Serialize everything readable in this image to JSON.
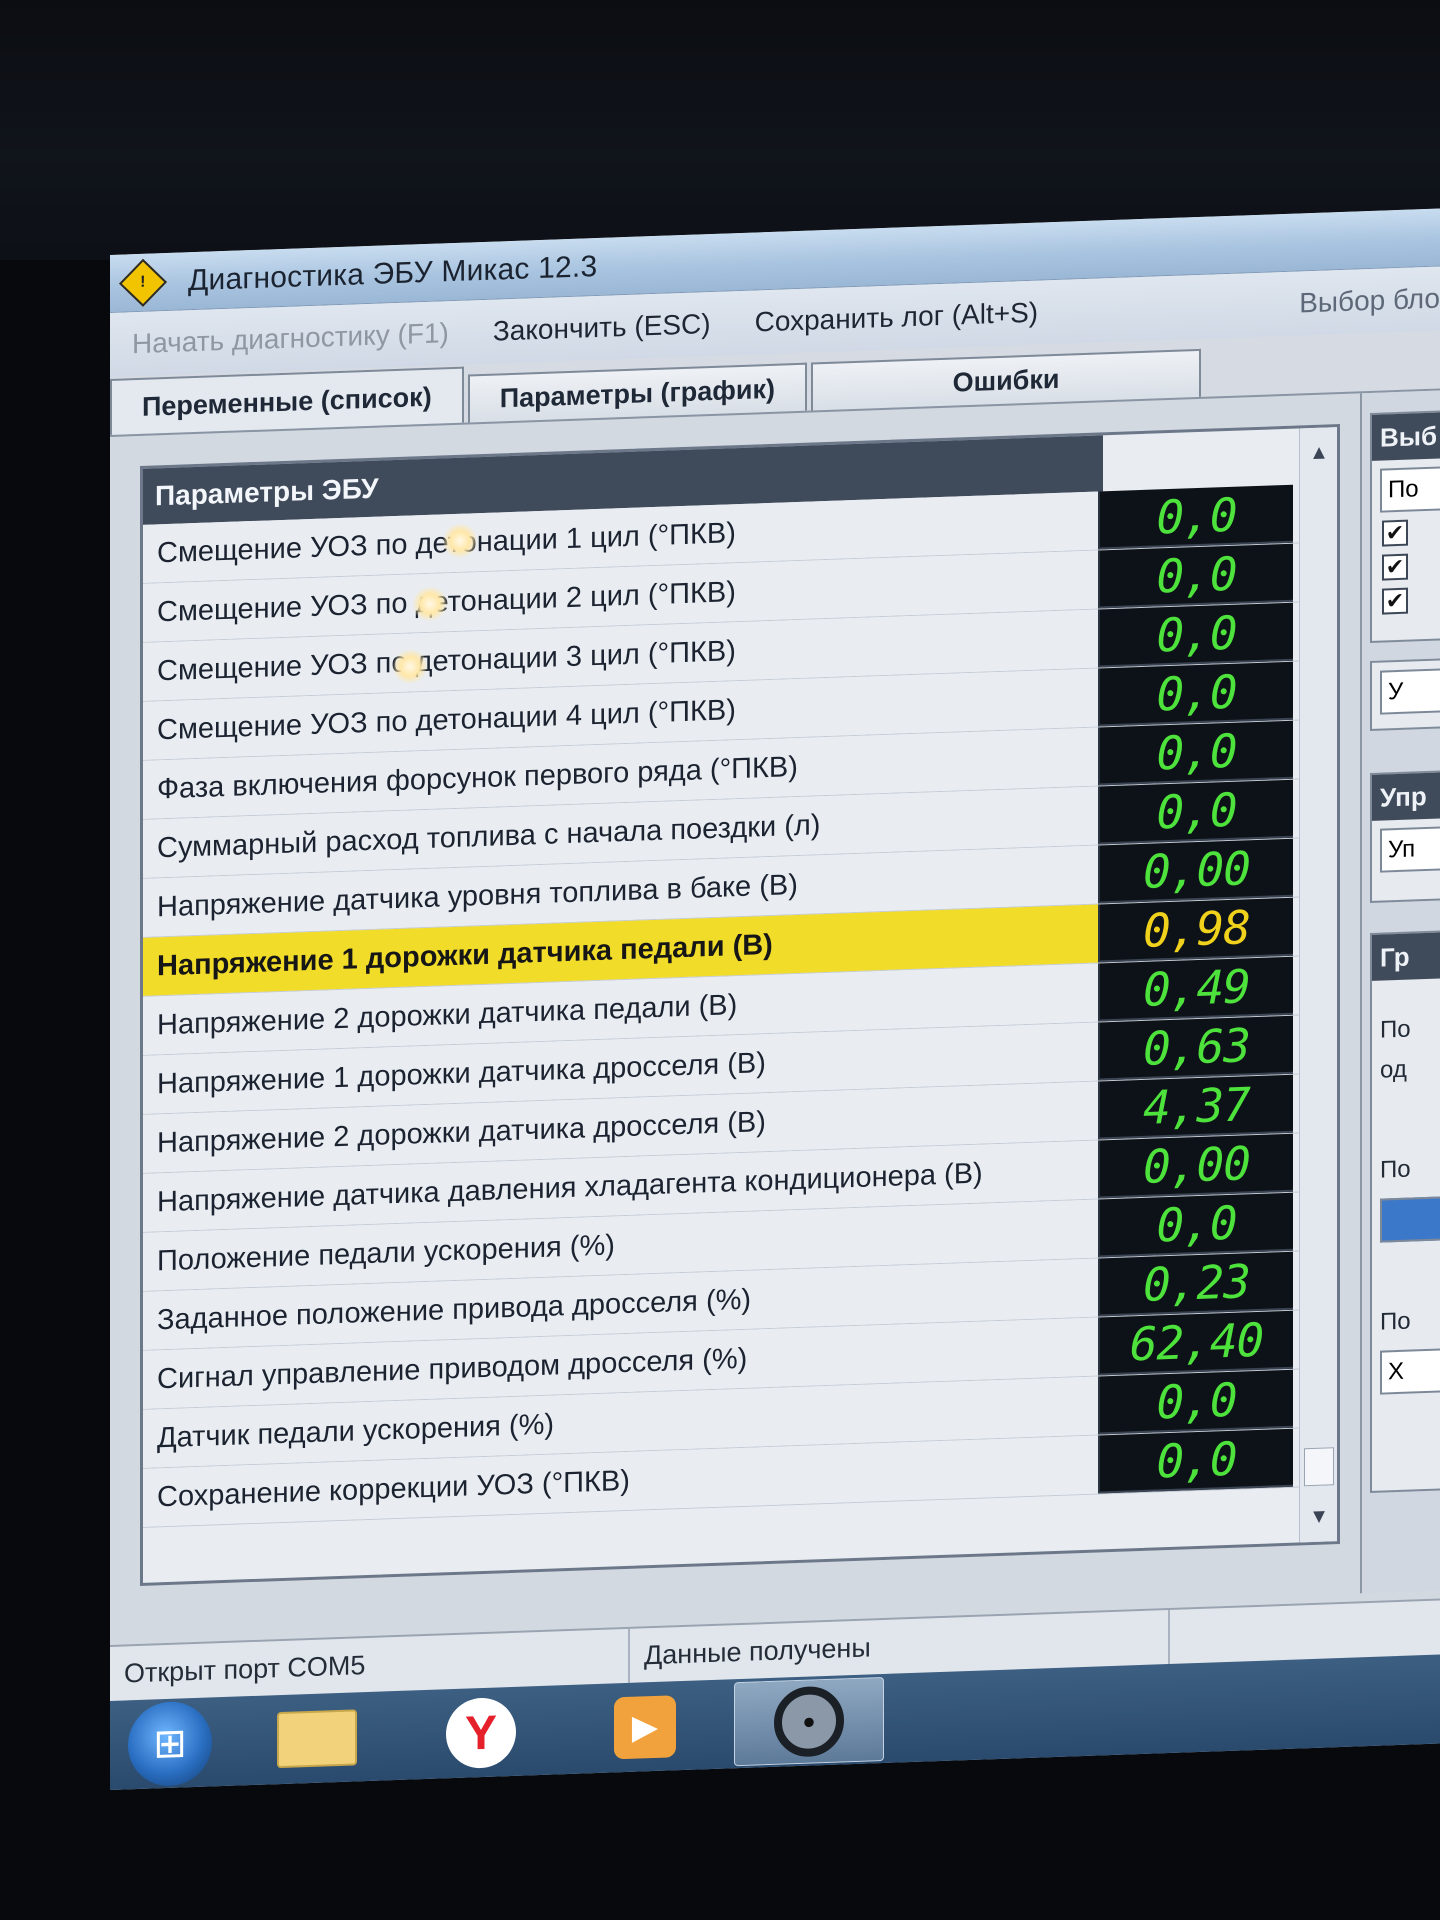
{
  "window": {
    "title": "Диагностика ЭБУ Микас 12.3"
  },
  "menu": {
    "start_diag": "Начать диагностику (F1)",
    "finish": "Закончить (ESC)",
    "save_log": "Сохранить лог (Alt+S)",
    "select_block": "Выбор бло"
  },
  "tabs": [
    {
      "label": "Переменные (список)"
    },
    {
      "label": "Параметры (график)"
    },
    {
      "label": "Ошибки"
    }
  ],
  "panel": {
    "header": "Параметры ЭБУ",
    "rows": [
      {
        "label": "Смещение УОЗ по детонации 1 цил (°ПКВ)",
        "value": "0,0"
      },
      {
        "label": "Смещение УОЗ по детонации 2 цил (°ПКВ)",
        "value": "0,0"
      },
      {
        "label": "Смещение УОЗ по детонации 3 цил (°ПКВ)",
        "value": "0,0"
      },
      {
        "label": "Смещение УОЗ по детонации 4 цил (°ПКВ)",
        "value": "0,0"
      },
      {
        "label": "Фаза включения форсунок первого ряда (°ПКВ)",
        "value": "0,0"
      },
      {
        "label": "Суммарный расход топлива с начала поездки (л)",
        "value": "0,0"
      },
      {
        "label": "Напряжение датчика уровня топлива в баке (В)",
        "value": "0,00"
      },
      {
        "label": "Напряжение 1 дорожки датчика педали (В)",
        "value": "0,98"
      },
      {
        "label": "Напряжение 2 дорожки датчика педали (В)",
        "value": "0,49"
      },
      {
        "label": "Напряжение 1 дорожки датчика дросселя (В)",
        "value": "0,63"
      },
      {
        "label": "Напряжение 2 дорожки датчика дросселя (В)",
        "value": "4,37"
      },
      {
        "label": "Напряжение датчика давления хладагента кондиционера (В)",
        "value": "0,00"
      },
      {
        "label": "Положение педали ускорения (%)",
        "value": "0,0"
      },
      {
        "label": "Заданное положение привода дросселя (%)",
        "value": "0,23"
      },
      {
        "label": "Сигнал управление приводом дросселя (%)",
        "value": "62,40"
      },
      {
        "label": "Датчик педали ускорения (%)",
        "value": "0,0"
      },
      {
        "label": "Сохранение коррекции УОЗ (°ПКВ)",
        "value": "0,0"
      }
    ]
  },
  "side": {
    "block1_head": "Выб",
    "block1_input": "По",
    "block2_button": "У",
    "block3_head": "Упр",
    "block3_input": "Уп",
    "block4_head": "Гр",
    "block4_text1": "По",
    "block4_text2": "од",
    "block4_text3": "По",
    "block4_text4": "По",
    "block4_input": "Х"
  },
  "status": {
    "port": "Открыт порт COM5",
    "data": "Данные получены"
  },
  "colors": {
    "value_normal": "#4ee23c",
    "value_highlight": "#f0d11c",
    "row_highlight": "#f2dc2a"
  }
}
